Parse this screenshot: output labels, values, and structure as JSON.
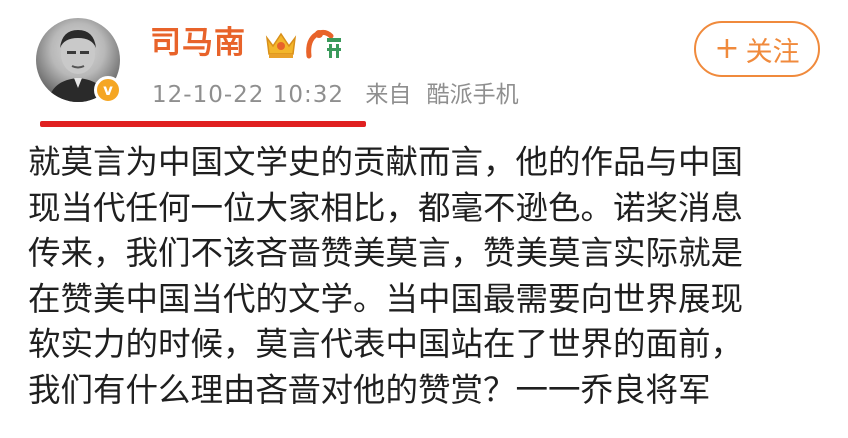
{
  "post": {
    "author": {
      "name": "司马南",
      "verified_mark": "v",
      "badges": [
        "crown-icon",
        "vip-icon"
      ]
    },
    "meta": {
      "time": "12-10-22 10:32",
      "source_prefix": "来自",
      "source": "酷派手机"
    },
    "follow_button": {
      "plus": "+",
      "label": "关注"
    },
    "content_lines": [
      "就莫言为中国文学史的贡献而言，他的作品与中国",
      "现当代任何一位大家相比，都毫不逊色。诺奖消息",
      "传来，我们不该吝啬赞美莫言，赞美莫言实际就是",
      "在赞美中国当代的文学。当中国最需要向世界展现",
      "软实力的时候，莫言代表中国站在了世界的面前，",
      "我们有什么理由吝啬对他的赞赏？一一乔良将军"
    ],
    "colors": {
      "username": "#e8632a",
      "meta": "#8f8f8f",
      "follow": "#f08a3c",
      "underline": "#e02020",
      "verified": "#f5a623"
    }
  }
}
